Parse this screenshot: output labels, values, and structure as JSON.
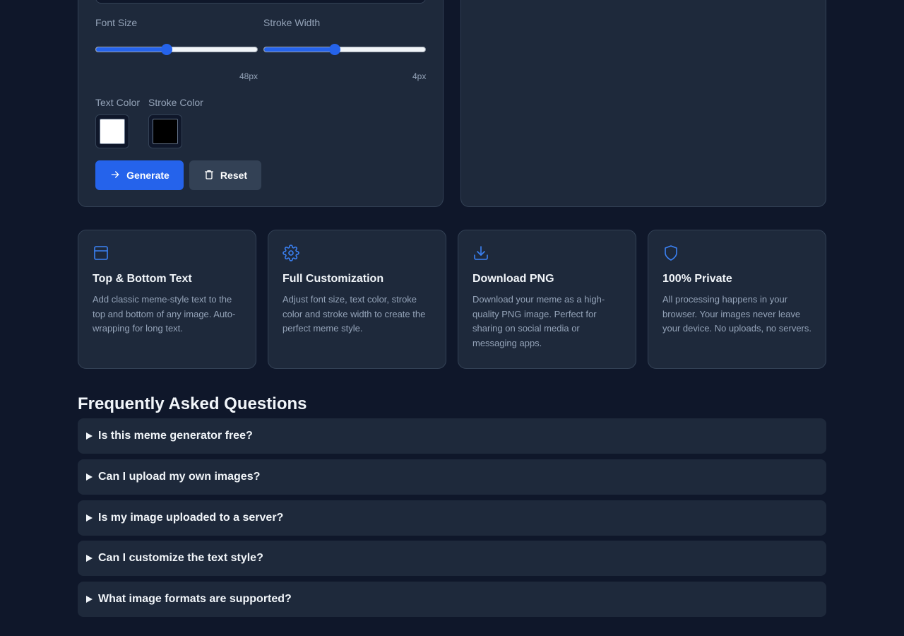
{
  "controls": {
    "font_size_label": "Font Size",
    "stroke_width_label": "Stroke Width",
    "font_size_value": "48px",
    "font_size_fraction": 0.44,
    "stroke_width_value": "4px",
    "stroke_width_fraction": 0.44,
    "text_color_label": "Text Color",
    "stroke_color_label": "Stroke Color",
    "text_color": "#ffffff",
    "stroke_color": "#000000",
    "generate_label": "Generate",
    "reset_label": "Reset"
  },
  "features": [
    {
      "icon": "layout-icon",
      "title": "Top & Bottom Text",
      "description": "Add classic meme-style text to the top and bottom of any image. Auto-wrapping for long text."
    },
    {
      "icon": "gear-icon",
      "title": "Full Customization",
      "description": "Adjust font size, text color, stroke color and stroke width to create the perfect meme style."
    },
    {
      "icon": "download-icon",
      "title": "Download PNG",
      "description": "Download your meme as a high-quality PNG image. Perfect for sharing on social media or messaging apps."
    },
    {
      "icon": "shield-icon",
      "title": "100% Private",
      "description": "All processing happens in your browser. Your images never leave your device. No uploads, no servers."
    }
  ],
  "faq": {
    "title": "Frequently Asked Questions",
    "items": [
      "Is this meme generator free?",
      "Can I upload my own images?",
      "Is my image uploaded to a server?",
      "Can I customize the text style?",
      "What image formats are supported?"
    ]
  },
  "colors": {
    "accent": "#2563eb",
    "background": "#0f172a",
    "panel": "#1e293b"
  }
}
